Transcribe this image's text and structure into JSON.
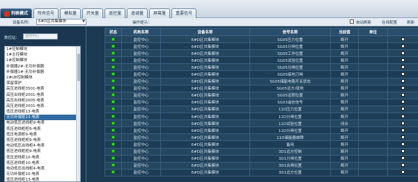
{
  "tabs": [
    {
      "label": "列表模式",
      "active": true
    },
    {
      "label": "所有信号",
      "active": false
    },
    {
      "label": "模拟量",
      "active": false
    },
    {
      "label": "开关量",
      "active": false
    },
    {
      "label": "遥控量",
      "active": false
    },
    {
      "label": "遥调量",
      "active": false
    },
    {
      "label": "屏幕量",
      "active": false
    },
    {
      "label": "重要信号",
      "active": false
    }
  ],
  "toolbar": {
    "device_label": "设备名称：",
    "device_value": "6#D区共集模块",
    "op_label": "操作提示：",
    "auto_refresh": "自动刷新",
    "online_config": "在线配置",
    "refresh": "刷新"
  },
  "left": {
    "filter_label": "数控站：",
    "filter_placeholder": "监控中心",
    "items": [
      "1#控制模块",
      "1#主控模块",
      "1#控制模块",
      "补偿器2#-无功补偿器",
      "补偿器1#-无功补偿器",
      "2#UE控制模块",
      "保留保护",
      "高压进线柜3501-电表",
      "高压出线柜2001-电表",
      "高压出线柜2005-电表",
      "高压进线柜2001-电表",
      "低压进线柜13-电表",
      "无功补偿柜23-电表",
      "电动低压进线柜9-电表",
      "低压进线柜柜9-电表",
      "低压电源柜9-电表",
      "低压进线柜柜9-电表",
      "电动低压出线柜4-电表",
      "低压进线柜柜9-电表",
      "低压进线柜10-电表",
      "低压进线柜10-电表",
      "电动低压出线柜4-电表",
      "无功补偿柜10-电表",
      "低压进线柜13-电表",
      "低压进线柜柜11-电表"
    ],
    "selected_index": 12
  },
  "table": {
    "headers": [
      "状态",
      "机构名称",
      "设备名称",
      "信号名称",
      "当前值",
      "单位",
      ""
    ],
    "rows": [
      [
        "监控中心",
        "6#D区共集模块",
        "SG05压力位置",
        "断开",
        ""
      ],
      [
        "监控中心",
        "6#D区共集模块",
        "SG05分闸位置",
        "断开",
        ""
      ],
      [
        "监控中心",
        "6#D区共集模块",
        "SG05工作位置",
        "断开",
        ""
      ],
      [
        "监控中心",
        "6#D区共集模块",
        "SG05试验位置",
        "断开",
        ""
      ],
      [
        "监控中心",
        "6#D区共集模块",
        "SG05分闸位置",
        "断开",
        ""
      ],
      [
        "监控中心",
        "6#D区共集模块",
        "SG05接地刀闸",
        "断开",
        ""
      ],
      [
        "监控中心",
        "6#D区共集模块",
        "SG05储能电路开关状态",
        "断开",
        ""
      ],
      [
        "监控中心",
        "6#D区共集模块",
        "SG05远方/就地",
        "断开",
        ""
      ],
      [
        "监控中心",
        "6#D区共集模块",
        "SG05远程位置",
        "断开",
        ""
      ],
      [
        "监控中心",
        "6#D区共集模块",
        "SG03遥信信号",
        "断开",
        ""
      ],
      [
        "监控中心",
        "6#D区共集模块",
        "11D压力位置",
        "断开",
        ""
      ],
      [
        "监控中心",
        "6#D区共集模块",
        "11D分闸位置",
        "断开",
        ""
      ],
      [
        "监控中心",
        "6#D区共集模块",
        "11D试验位置",
        "闭合",
        ""
      ],
      [
        "监控中心",
        "6#D区共集模块",
        "11D分闸位置",
        "断开",
        ""
      ],
      [
        "监控中心",
        "6#D区共集模块",
        "11D储能器故障",
        "断开",
        ""
      ],
      [
        "监控中心",
        "6#D区共集模块",
        "备用",
        "断开",
        ""
      ],
      [
        "监控中心",
        "6#D区共集模块",
        "3D1远方控制",
        "断开",
        ""
      ],
      [
        "监控中心",
        "6#D区共集模块",
        "3D1分闸位置",
        "断开",
        ""
      ],
      [
        "监控中心",
        "6#D区共集模块",
        "3D1合闸位置",
        "断开",
        ""
      ],
      [
        "监控中心",
        "6#D区共集模块",
        "3D1远方位置",
        "断开",
        ""
      ]
    ]
  },
  "colors": {
    "led": "#3bd13b",
    "bg": "#1c3a52",
    "header": "#2a4d6c"
  }
}
